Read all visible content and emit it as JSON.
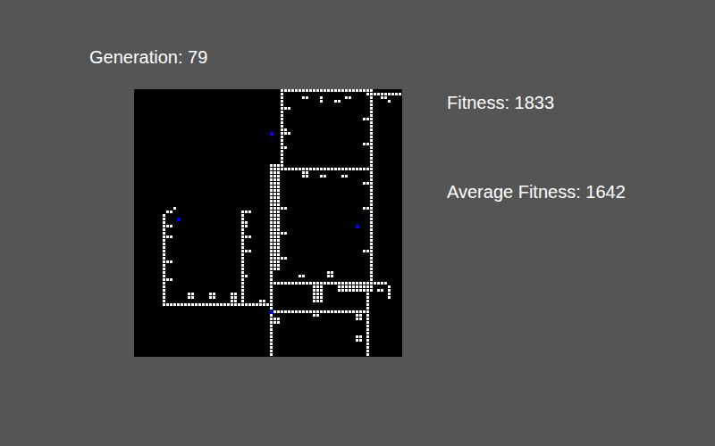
{
  "generation": {
    "label": "Generation: 79"
  },
  "stats": [
    {
      "label": "Fitness: 1833"
    },
    {
      "label": "Average Fitness: 1642"
    }
  ],
  "grid": {
    "size": 75,
    "walls": [
      [
        41,
        0,
        65,
        0
      ],
      [
        65,
        1,
        74,
        1
      ],
      [
        69,
        2,
        70,
        2
      ],
      [
        71,
        3,
        71,
        3
      ],
      [
        41,
        0,
        41,
        21
      ],
      [
        42,
        5,
        43,
        5
      ],
      [
        42,
        11,
        42,
        11
      ],
      [
        42,
        12,
        43,
        12
      ],
      [
        42,
        16,
        42,
        16
      ],
      [
        66,
        0,
        66,
        56
      ],
      [
        64,
        8,
        65,
        8
      ],
      [
        64,
        15,
        65,
        15
      ],
      [
        64,
        26,
        65,
        26
      ],
      [
        64,
        33,
        65,
        33
      ],
      [
        64,
        45,
        65,
        45
      ],
      [
        47,
        2,
        48,
        2
      ],
      [
        52,
        2,
        52,
        3
      ],
      [
        59,
        2,
        60,
        2
      ],
      [
        56,
        3,
        57,
        3
      ],
      [
        38,
        21,
        40,
        21
      ],
      [
        38,
        21,
        38,
        74
      ],
      [
        39,
        22,
        40,
        50
      ],
      [
        38,
        22,
        66,
        22
      ],
      [
        47,
        23,
        48,
        24
      ],
      [
        52,
        24,
        53,
        24
      ],
      [
        58,
        24,
        59,
        24
      ],
      [
        41,
        33,
        42,
        33
      ],
      [
        41,
        40,
        42,
        40
      ],
      [
        41,
        47,
        42,
        47
      ],
      [
        38,
        54,
        70,
        54
      ],
      [
        46,
        52,
        47,
        52
      ],
      [
        54,
        51,
        55,
        52
      ],
      [
        57,
        55,
        66,
        56
      ],
      [
        50,
        55,
        52,
        59
      ],
      [
        71,
        55,
        71,
        58
      ],
      [
        68,
        56,
        69,
        56
      ],
      [
        10,
        60,
        38,
        60
      ],
      [
        8,
        60,
        9,
        60
      ],
      [
        38,
        62,
        65,
        62
      ],
      [
        39,
        64,
        40,
        65
      ],
      [
        50,
        63,
        51,
        63
      ],
      [
        8,
        35,
        8,
        59
      ],
      [
        9,
        34,
        10,
        34
      ],
      [
        11,
        33,
        11,
        33
      ],
      [
        9,
        38,
        10,
        38
      ],
      [
        9,
        41,
        10,
        41
      ],
      [
        9,
        48,
        10,
        48
      ],
      [
        9,
        53,
        10,
        53
      ],
      [
        30,
        34,
        30,
        59
      ],
      [
        31,
        34,
        32,
        34
      ],
      [
        31,
        37,
        31,
        38
      ],
      [
        31,
        41,
        32,
        41
      ],
      [
        31,
        45,
        32,
        45
      ],
      [
        31,
        52,
        31,
        52
      ],
      [
        15,
        57,
        16,
        58
      ],
      [
        21,
        57,
        22,
        58
      ],
      [
        27,
        57,
        28,
        59
      ],
      [
        35,
        59,
        36,
        59
      ],
      [
        65,
        57,
        65,
        74
      ],
      [
        62,
        63,
        63,
        64
      ],
      [
        62,
        69,
        63,
        70
      ]
    ],
    "agents": [
      {
        "col": 38,
        "row": 12,
        "color": "#0000ff"
      },
      {
        "col": 12,
        "row": 36,
        "color": "#0000ff"
      },
      {
        "col": 62,
        "row": 38,
        "color": "#0000ff"
      },
      {
        "col": 38,
        "row": 62,
        "color": "#0000ff"
      }
    ]
  }
}
